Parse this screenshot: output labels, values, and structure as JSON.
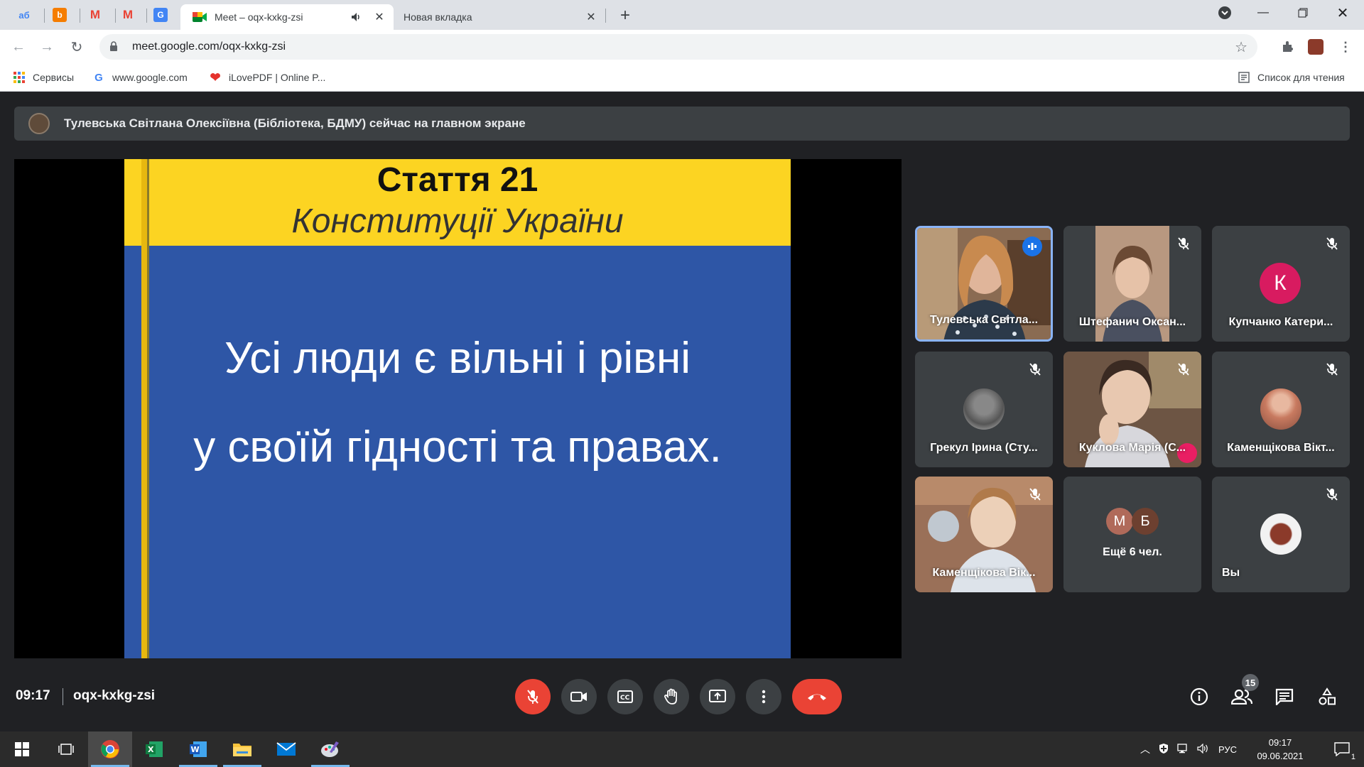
{
  "browser": {
    "tabs": [
      {
        "title": "Meet – oqx-kxkg-zsi",
        "active": true
      },
      {
        "title": "Новая вкладка",
        "active": false
      }
    ],
    "url": "meet.google.com/oqx-kxkg-zsi",
    "bookmarks": [
      {
        "label": "Сервисы"
      },
      {
        "label": "www.google.com"
      },
      {
        "label": "iLovePDF | Online P..."
      }
    ],
    "reading_list": "Список для чтения"
  },
  "meet": {
    "presenter_notice": "Тулевська Світлана Олексіївна (Бібліотека, БДМУ) сейчас на главном экране",
    "slide": {
      "title": "Стаття 21",
      "subtitle": "Конституції України",
      "line1": "Усі люди є вільні і рівні",
      "line2": "у своїй гідності та правах."
    },
    "participants": [
      {
        "name": "Тулевська Світла...",
        "speaking": true
      },
      {
        "name": "Штефанич Оксан..."
      },
      {
        "name": "Купчанко Катери...",
        "initial": "К",
        "color": "#d81b60"
      },
      {
        "name": "Грекул Ірина (Сту..."
      },
      {
        "name": "Куклова Марія (С..."
      },
      {
        "name": "Каменщікова Вікт..."
      },
      {
        "name": "Каменщікова Вік..."
      },
      {
        "name": "Ещё 6 чел.",
        "initials": [
          "М",
          "Б"
        ]
      },
      {
        "name": "Вы"
      }
    ],
    "time": "09:17",
    "meeting_code": "oqx-kxkg-zsi",
    "people_count": "15"
  },
  "taskbar": {
    "language": "РУС",
    "time": "09:17",
    "date": "09.06.2021",
    "notifications": "1"
  }
}
